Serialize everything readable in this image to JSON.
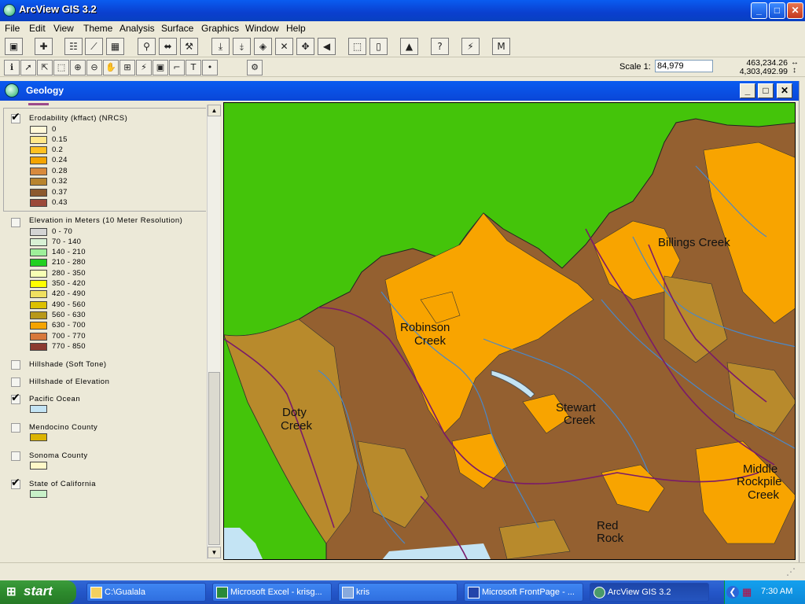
{
  "app": {
    "title": "ArcView GIS 3.2",
    "window_buttons": {
      "minimize": "_",
      "maximize": "□",
      "close": "✕"
    }
  },
  "menu": [
    "File",
    "Edit",
    "View",
    "Theme",
    "Analysis",
    "Surface",
    "Graphics",
    "Window",
    "Help"
  ],
  "toolbar": {
    "scale_label": "Scale 1:",
    "scale_value": "84,979",
    "coord_x": "463,234.26",
    "coord_y": "4,303,492.99",
    "m_button": "M"
  },
  "view": {
    "title": "Geology",
    "themes": [
      {
        "name": "Erodability (kffact) (NRCS)",
        "checked": true,
        "classes": [
          {
            "label": "0",
            "color": "#fff8d8"
          },
          {
            "label": "0.15",
            "color": "#ffe88a"
          },
          {
            "label": "0.2",
            "color": "#ffc020"
          },
          {
            "label": "0.24",
            "color": "#f4a400"
          },
          {
            "label": "0.28",
            "color": "#d88a3c"
          },
          {
            "label": "0.32",
            "color": "#b8842e"
          },
          {
            "label": "0.37",
            "color": "#8c5a2e"
          },
          {
            "label": "0.43",
            "color": "#9c4a3a"
          }
        ]
      },
      {
        "name": "Elevation in Meters (10 Meter Resolution)",
        "checked": false,
        "classes": [
          {
            "label": "0 - 70",
            "color": "#d4d4d4"
          },
          {
            "label": "70 - 140",
            "color": "#d8f0d4"
          },
          {
            "label": "140 - 210",
            "color": "#9ef09a"
          },
          {
            "label": "210 - 280",
            "color": "#22d020"
          },
          {
            "label": "280 - 350",
            "color": "#f6ffb4"
          },
          {
            "label": "350 - 420",
            "color": "#ffff00"
          },
          {
            "label": "420 - 490",
            "color": "#f0e060"
          },
          {
            "label": "490 - 560",
            "color": "#dcc000"
          },
          {
            "label": "560 - 630",
            "color": "#b89818"
          },
          {
            "label": "630 - 700",
            "color": "#f4a400"
          },
          {
            "label": "700 - 770",
            "color": "#d8783a"
          },
          {
            "label": "770 - 850",
            "color": "#8c3a30"
          }
        ]
      },
      {
        "name": "Hillshade (Soft Tone)",
        "checked": false,
        "classes": []
      },
      {
        "name": "Hillshade of Elevation",
        "checked": false,
        "classes": []
      },
      {
        "name": "Pacific Ocean",
        "checked": true,
        "classes": [
          {
            "label": "",
            "color": "#c4e4f4"
          }
        ]
      },
      {
        "name": "Mendocino County",
        "checked": false,
        "classes": [
          {
            "label": "",
            "color": "#dcb400"
          }
        ]
      },
      {
        "name": "Sonoma County",
        "checked": false,
        "classes": [
          {
            "label": "",
            "color": "#fff8c8"
          }
        ]
      },
      {
        "name": "State of California",
        "checked": true,
        "classes": [
          {
            "label": "",
            "color": "#c8f0c8"
          }
        ]
      }
    ],
    "map_labels": {
      "billings": "Billings Creek",
      "robinson1": "Robinson",
      "robinson2": "Creek",
      "doty1": "Doty",
      "doty2": "Creek",
      "stewart1": "Stewart",
      "stewart2": "Creek",
      "middle1": "Middle",
      "middle2": "Rockpile",
      "middle3": "Creek",
      "red1": "Red",
      "red2": "Rock"
    },
    "map_colors": {
      "land": "#44c40a",
      "soil_dark": "#946030",
      "soil_orange": "#f8a400",
      "soil_tan": "#b88a2c",
      "stream": "#4a88c8",
      "boundary": "#7a1a6a",
      "ocean": "#c4e4f4"
    }
  },
  "taskbar": {
    "start": "start",
    "tasks": [
      "C:\\Gualala",
      "Microsoft Excel - krisg...",
      "kris",
      "Microsoft FrontPage - ...",
      "ArcView GIS 3.2"
    ],
    "clock": "7:30 AM"
  }
}
